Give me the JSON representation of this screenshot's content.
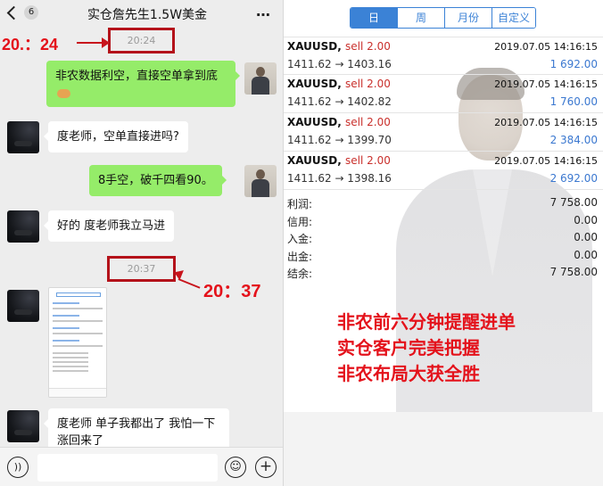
{
  "chat": {
    "unread_count": "6",
    "title": "实仓詹先生1.5W美金",
    "more_icon": "…",
    "annotations": {
      "first": "20.：24",
      "second": "20：37"
    },
    "times": [
      "20:24",
      "20:37"
    ],
    "messages": [
      {
        "from": "me",
        "text": "非农数据利空，直接空单拿到底"
      },
      {
        "from": "other",
        "text": "度老师，空单直接进吗?"
      },
      {
        "from": "me",
        "text": "8手空，破千四看90。"
      },
      {
        "from": "other",
        "text": "好的 度老师我立马进"
      },
      {
        "from": "other",
        "text": "度老师 单子我都出了 我怕一下涨回来了"
      }
    ]
  },
  "history": {
    "tabs": [
      "日",
      "周",
      "月份",
      "自定义"
    ],
    "active_tab": "日",
    "trades": [
      {
        "symbol": "XAUUSD,",
        "side": "sell 2.00",
        "datetime": "2019.07.05 14:16:15",
        "prices": "1411.62 → 1403.16",
        "profit": "1 692.00"
      },
      {
        "symbol": "XAUUSD,",
        "side": "sell 2.00",
        "datetime": "2019.07.05 14:16:15",
        "prices": "1411.62 → 1402.82",
        "profit": "1 760.00"
      },
      {
        "symbol": "XAUUSD,",
        "side": "sell 2.00",
        "datetime": "2019.07.05 14:16:15",
        "prices": "1411.62 → 1399.70",
        "profit": "2 384.00"
      },
      {
        "symbol": "XAUUSD,",
        "side": "sell 2.00",
        "datetime": "2019.07.05 14:16:15",
        "prices": "1411.62 → 1398.16",
        "profit": "2 692.00"
      }
    ],
    "summary": [
      {
        "label": "利润:",
        "value": "7 758.00"
      },
      {
        "label": "信用:",
        "value": "0.00"
      },
      {
        "label": "入金:",
        "value": "0.00"
      },
      {
        "label": "出金:",
        "value": "0.00"
      },
      {
        "label": "结余:",
        "value": "7 758.00"
      }
    ],
    "promo": [
      "非农前六分钟提醒进单",
      "实仓客户完美把握",
      "非农布局大获全胜"
    ]
  },
  "colors": {
    "accent_blue": "#3b82d6",
    "sell_red": "#c9302c",
    "annotation_red": "#e4121b",
    "wechat_green": "#95ec69"
  }
}
